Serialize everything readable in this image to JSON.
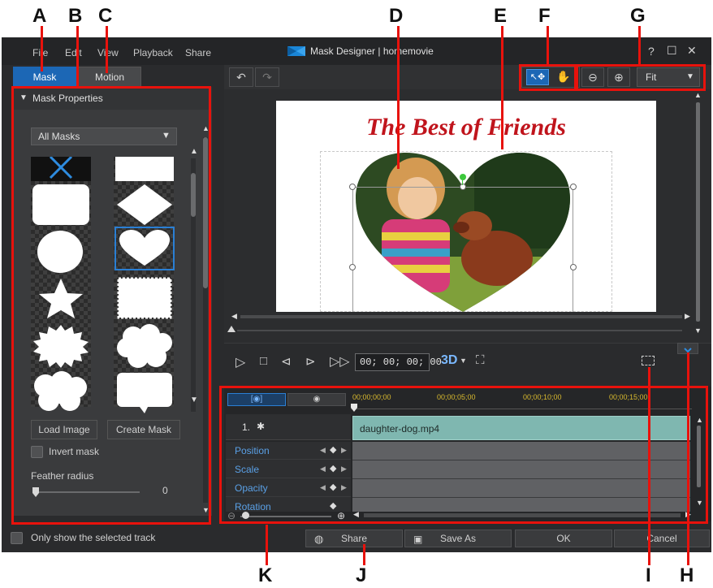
{
  "window": {
    "title": "Mask Designer | homemovie",
    "help_glyph": "?",
    "maximize_glyph": "☐",
    "close_glyph": "✕"
  },
  "menu": [
    "File",
    "Edit",
    "View",
    "Playback",
    "Share"
  ],
  "tabs": {
    "mask": "Mask",
    "motion": "Motion"
  },
  "mask_panel": {
    "section_title": "Mask Properties",
    "filter_value": "All Masks",
    "load_image_label": "Load Image",
    "create_mask_label": "Create Mask",
    "invert_mask_label": "Invert mask",
    "feather_radius_label": "Feather radius",
    "feather_radius_value": "0",
    "feather_radius_fraction": 0
  },
  "toolbar": {
    "zoom_value": "Fit"
  },
  "preview": {
    "title_text": "The Best of Friends"
  },
  "playback": {
    "timecode": "00; 00; 00; 00",
    "stereo_label": "3D"
  },
  "timeline": {
    "ruler": [
      "00;00;00;00",
      "00;00;05;00",
      "00;00;10;00",
      "00;00;15;00"
    ],
    "track_name": "1.",
    "clip_name": "daughter-dog.mp4",
    "attributes": [
      "Position",
      "Scale",
      "Opacity",
      "Rotation"
    ]
  },
  "footer": {
    "only_selected_track_label": "Only show the selected track",
    "share_label": "Share",
    "save_as_label": "Save As",
    "ok_label": "OK",
    "cancel_label": "Cancel"
  },
  "callouts": {
    "a": "A",
    "b": "B",
    "c": "C",
    "d": "D",
    "e": "E",
    "f": "F",
    "g": "G",
    "h": "H",
    "i": "I",
    "j": "J",
    "k": "K"
  },
  "colors": {
    "accent_red": "#e8120c",
    "selection_blue": "#2a7fd4",
    "clip_teal": "#7fb7b0",
    "title_red": "#c0141c",
    "timecode_yellow": "#d8b92e"
  }
}
